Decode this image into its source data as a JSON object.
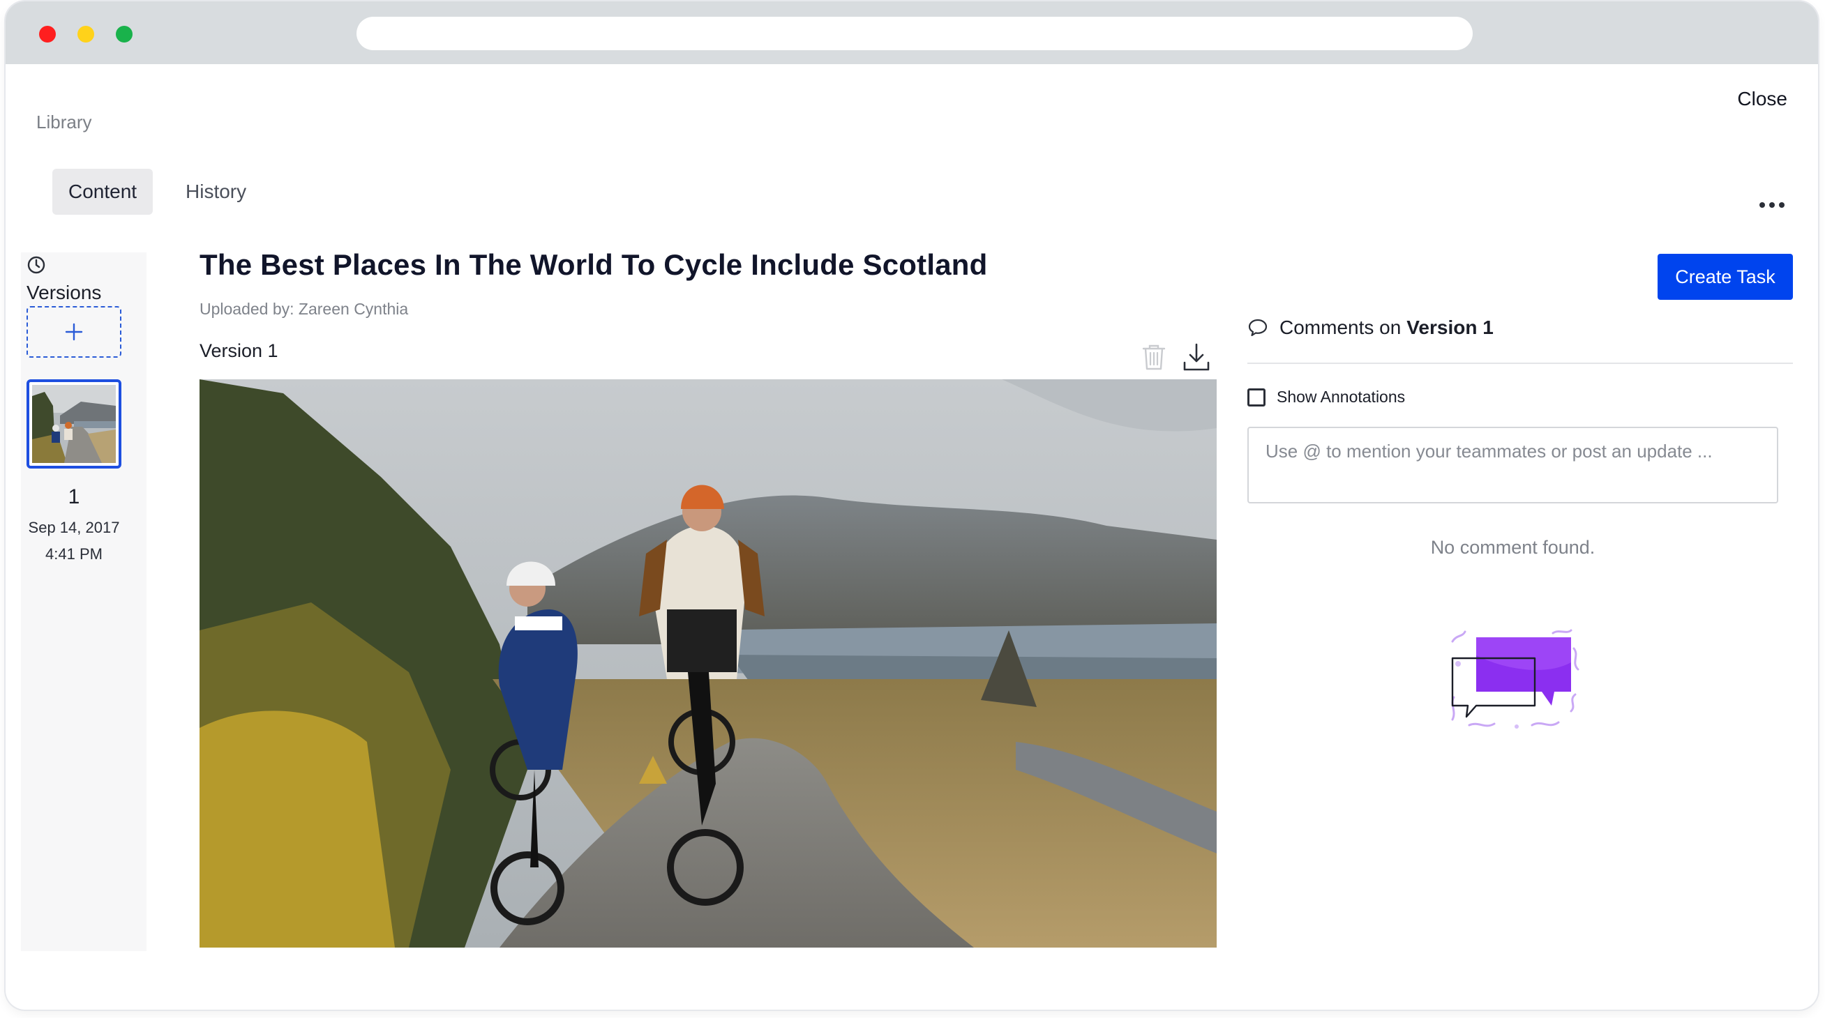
{
  "nav": {
    "breadcrumb": "Library",
    "close_label": "Close",
    "tabs": [
      {
        "label": "Content",
        "active": true
      },
      {
        "label": "History",
        "active": false
      }
    ],
    "more_icon": "more-horizontal-icon"
  },
  "versions": {
    "label": "Versions",
    "icon": "clock-icon",
    "add_icon": "plus-icon",
    "items": [
      {
        "number": "1",
        "date": "Sep 14, 2017",
        "time": "4:41 PM",
        "selected": true
      }
    ]
  },
  "content": {
    "title": "The Best Places In The World To Cycle Include Scotland",
    "uploaded_by": "Uploaded by: Zareen Cynthia",
    "version_label": "Version 1",
    "actions": {
      "delete_icon": "trash-icon",
      "download_icon": "download-icon"
    }
  },
  "comments": {
    "create_task_label": "Create Task",
    "header_prefix": "Comments on",
    "header_version": "Version 1",
    "show_annotations_label": "Show Annotations",
    "show_annotations_checked": false,
    "input_placeholder": "Use @ to mention your teammates or post an update ...",
    "empty_text": "No comment found.",
    "empty_illustration": "speech-bubbles-illustration"
  },
  "colors": {
    "accent": "#0044ee",
    "selected_border": "#1e4fe0",
    "illustration_purple": "#8b2ff0"
  }
}
